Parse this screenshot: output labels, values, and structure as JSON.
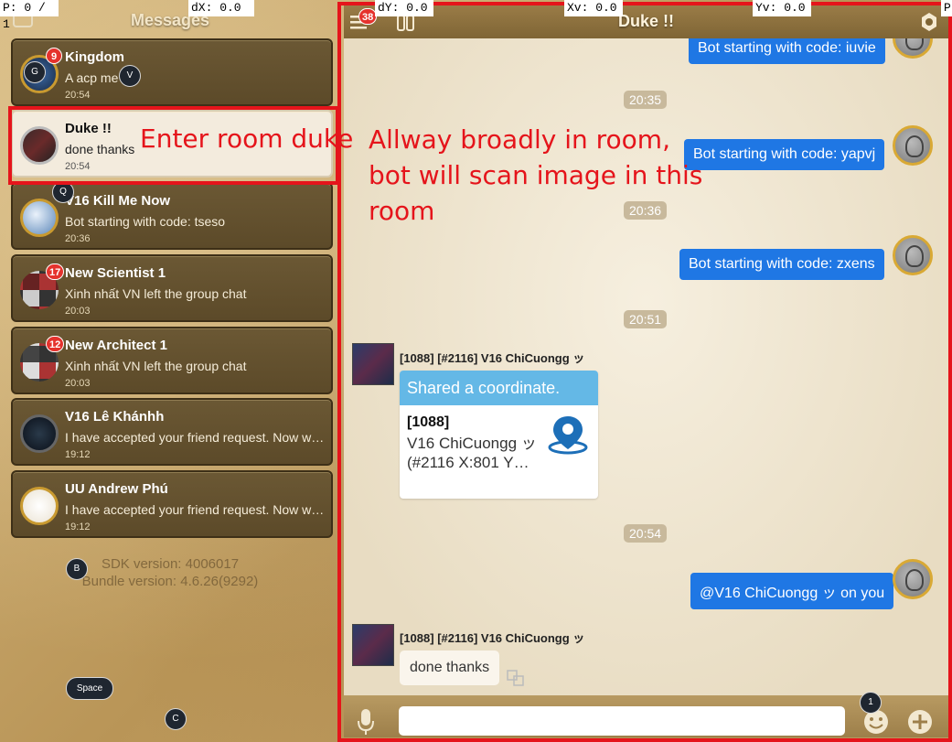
{
  "debug": {
    "p": "P: 0 / 1",
    "dx": "dX: 0.0",
    "dy": "dY: 0.0",
    "xv": "Xv: 0.0",
    "yv": "Yv: 0.0",
    "pr": "P"
  },
  "left": {
    "title": "Messages",
    "conversations": [
      {
        "name": "Kingdom",
        "preview": "A acp me",
        "time": "20:54",
        "badge": "9"
      },
      {
        "name": "Duke !!",
        "preview": "done thanks",
        "time": "20:54",
        "badge": ""
      },
      {
        "name": "V16 Kill Me Now",
        "preview": "Bot starting with code: tseso",
        "time": "20:36",
        "badge": ""
      },
      {
        "name": "New Scientist 1",
        "preview": "Xinh nhất VN left the group chat",
        "time": "20:03",
        "badge": "17"
      },
      {
        "name": "New Architect 1",
        "preview": "Xinh nhất VN left the group chat",
        "time": "20:03",
        "badge": "12"
      },
      {
        "name": "V16 Lê Khánhh",
        "preview": "I have accepted your friend request. Now we...",
        "time": "19:12",
        "badge": ""
      },
      {
        "name": "UU Andrew Phú",
        "preview": "I have accepted your friend request. Now we...",
        "time": "19:12",
        "badge": ""
      }
    ],
    "sdk_version": "SDK version: 4006017",
    "bundle_version": "Bundle version: 4.6.26(9292)"
  },
  "keys": {
    "g": "G",
    "v": "V",
    "q": "Q",
    "b": "B",
    "space": "Space",
    "c": "C",
    "one": "1"
  },
  "annotations": {
    "enter_room": "Enter room duke",
    "broadly": [
      "Allway broadly in room,",
      "bot will scan image in this",
      "room"
    ]
  },
  "chat": {
    "title": "Duke !!",
    "menu_badge": "38",
    "messages": {
      "m1": "Bot starting with code: iuvie",
      "t1": "20:35",
      "m2": "Bot starting with code: yapvj",
      "t2": "20:36",
      "m3": "Bot starting with code: zxens",
      "t3": "20:51",
      "sender1": "[1088] [#2116] V16 ChiCuongg ッ",
      "coord_head": "Shared a coordinate.",
      "coord_id": "[1088]",
      "coord_text": "V16 ChiCuongg ッ (#2116 X:801 Y…",
      "t4": "20:54",
      "m4": "@V16 ChiCuongg ッ  on you",
      "sender2": "[1088] [#2116] V16 ChiCuongg ッ",
      "m5": "done thanks"
    }
  },
  "colors": {
    "accent_red": "#e5141b",
    "bubble_blue": "#1f77e4",
    "coord_blue": "#64b8e6"
  }
}
